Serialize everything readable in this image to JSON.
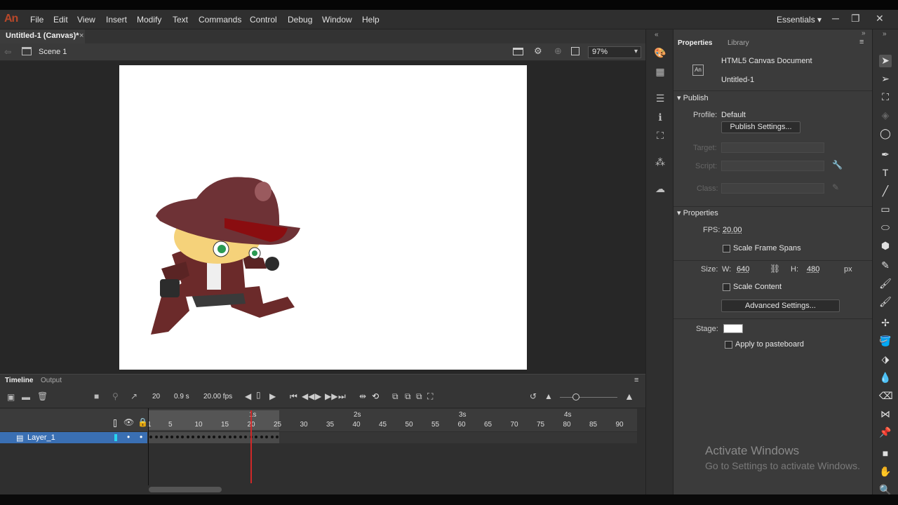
{
  "app": {
    "logo": "An",
    "workspace": "Essentials ▾"
  },
  "menu": [
    "File",
    "Edit",
    "View",
    "Insert",
    "Modify",
    "Text",
    "Commands",
    "Control",
    "Debug",
    "Window",
    "Help"
  ],
  "document": {
    "tab_title": "Untitled-1 (Canvas)*",
    "close": "×"
  },
  "scene": {
    "label": "Scene 1",
    "zoom": "97%"
  },
  "timeline": {
    "tabs": [
      "Timeline",
      "Output"
    ],
    "frame": "20",
    "time": "0.9 s",
    "fps": "20.00 fps",
    "ruler_seconds": [
      "1s",
      "2s",
      "3s",
      "4s"
    ],
    "ruler_frames": [
      "1",
      "5",
      "10",
      "15",
      "20",
      "25",
      "30",
      "35",
      "40",
      "45",
      "50",
      "55",
      "60",
      "65",
      "70",
      "75",
      "80",
      "85",
      "90"
    ],
    "layer_name": "Layer_1"
  },
  "properties": {
    "tabs": [
      "Properties",
      "Library"
    ],
    "doc_type": "HTML5 Canvas Document",
    "doc_name": "Untitled-1",
    "doc_icon": "An",
    "publish": {
      "header": "Publish",
      "profile_label": "Profile:",
      "profile_value": "Default",
      "publish_settings_button": "Publish Settings...",
      "target_label": "Target:",
      "script_label": "Script:",
      "class_label": "Class:"
    },
    "props": {
      "header": "Properties",
      "fps_label": "FPS:",
      "fps_value": "20.00",
      "scale_frame_spans": "Scale Frame Spans",
      "size_label": "Size:",
      "w_label": "W:",
      "w_value": "640",
      "h_label": "H:",
      "h_value": "480",
      "unit": "px",
      "scale_content": "Scale Content",
      "advanced_button": "Advanced Settings...",
      "stage_label": "Stage:",
      "stage_color": "#ffffff",
      "apply_pasteboard": "Apply to pasteboard"
    }
  },
  "watermark": {
    "line1": "Activate Windows",
    "line2": "Go to Settings to activate Windows."
  },
  "colors": {
    "accent": "#3a6fb3",
    "playhead": "#d02828",
    "logo": "#b9482a"
  }
}
